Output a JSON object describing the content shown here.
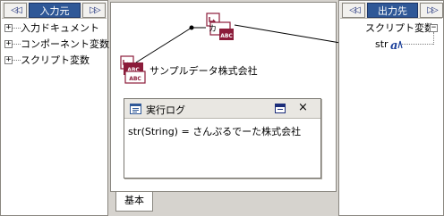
{
  "left_panel": {
    "title": "入力元",
    "back_glyph": "◁◁",
    "fwd_glyph": "▷▷",
    "items": [
      {
        "label": "入力ドキュメント",
        "expander": "+"
      },
      {
        "label": "コンポーネント変数",
        "expander": "+"
      },
      {
        "label": "スクリプト変数",
        "expander": "+"
      }
    ]
  },
  "right_panel": {
    "title": "出力先",
    "back_glyph": "◁◁",
    "fwd_glyph": "▷▷",
    "group_label": "スクリプト変数",
    "group_expander": "−",
    "variable_label": "str"
  },
  "canvas": {
    "node_label": "サンプルデータ株式会社",
    "icon_badge_text": "ABC",
    "convert_icon_text": "カ"
  },
  "log_window": {
    "title": "実行ログ",
    "content": "str(String) = さんぷるでーた株式会社",
    "close_glyph": "×"
  },
  "bottom_tab": {
    "label": "基本"
  },
  "colors": {
    "header_title_bg": "#2f5897",
    "nav_arrow": "#1b2d7a",
    "icon_accent": "#8b1c3a"
  }
}
